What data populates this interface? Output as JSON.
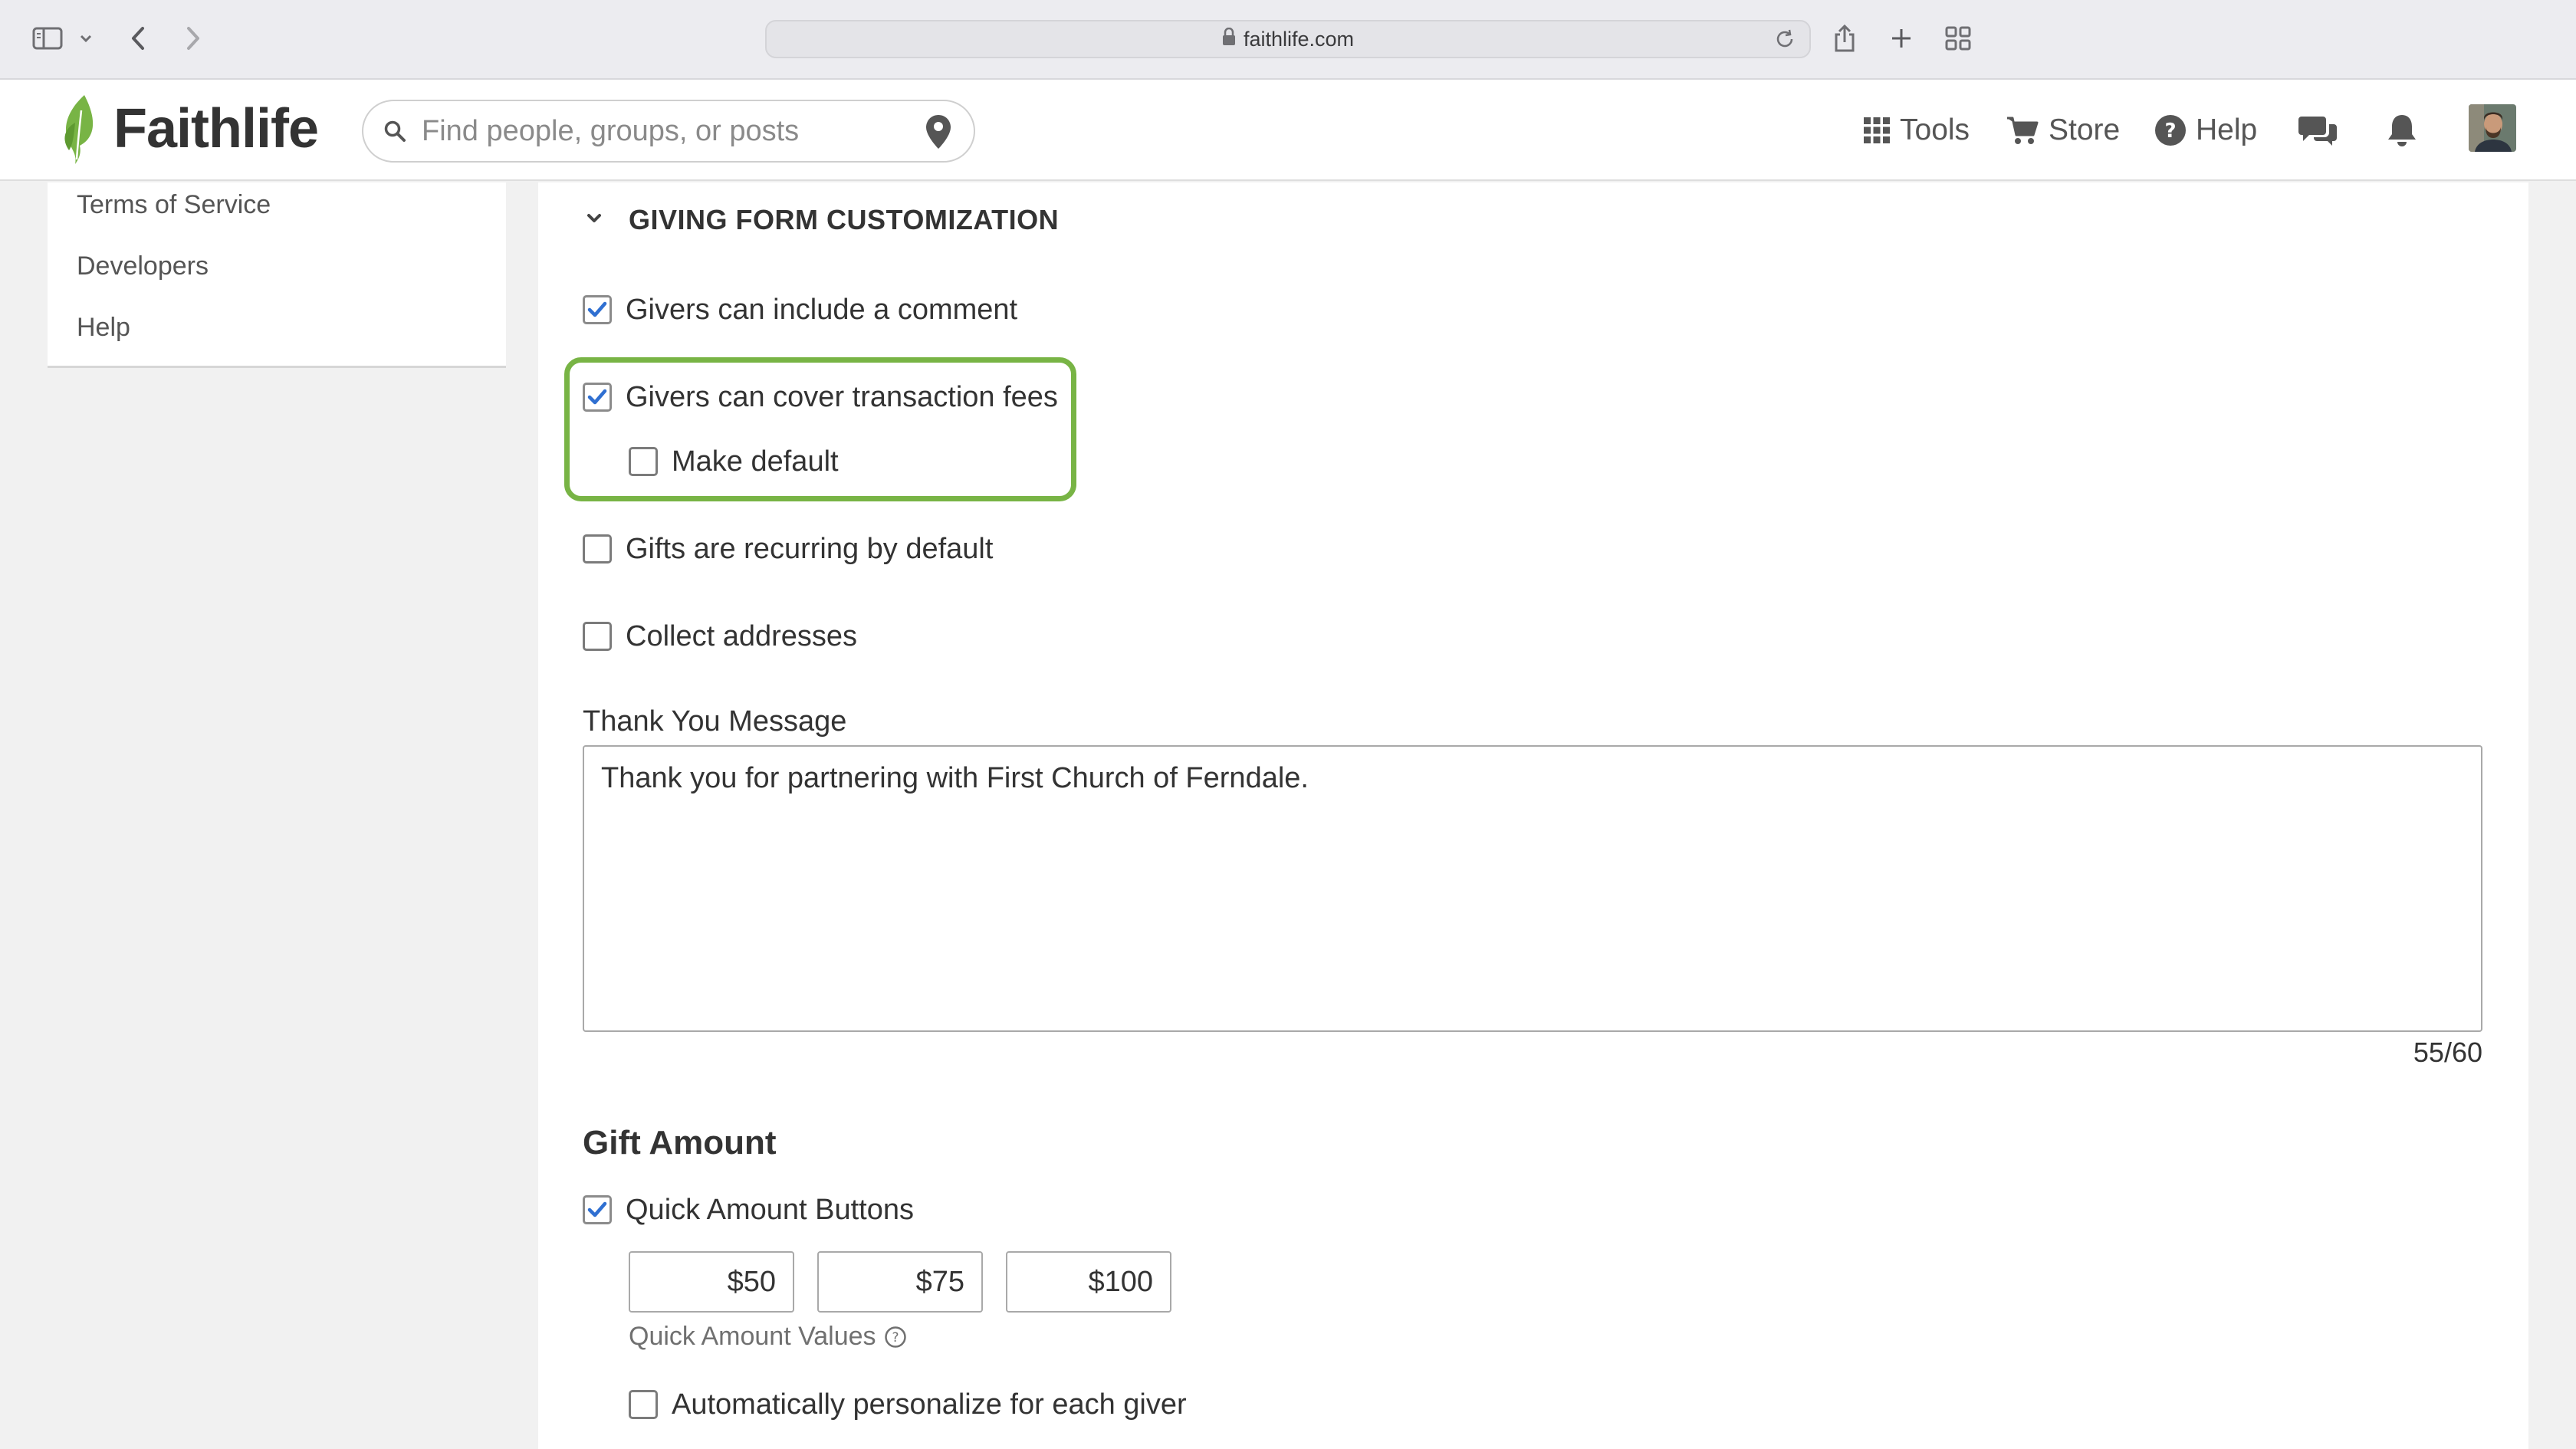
{
  "browser": {
    "url": "faithlife.com"
  },
  "header": {
    "logo_text": "Faithlife",
    "search_placeholder": "Find people, groups, or posts",
    "nav": {
      "tools": "Tools",
      "store": "Store",
      "help": "Help"
    }
  },
  "sidebar": {
    "links": [
      "Terms of Service",
      "Developers",
      "Help"
    ]
  },
  "main": {
    "section_title": "GIVING FORM CUSTOMIZATION",
    "options": {
      "include_comment": {
        "label": "Givers can include a comment",
        "checked": true
      },
      "cover_fees": {
        "label": "Givers can cover transaction fees",
        "checked": true
      },
      "make_default": {
        "label": "Make default",
        "checked": false
      },
      "recurring_default": {
        "label": "Gifts are recurring by default",
        "checked": false
      },
      "collect_addresses": {
        "label": "Collect addresses",
        "checked": false
      }
    },
    "thank_you": {
      "label": "Thank You Message",
      "value": "Thank you for partnering with First Church of Ferndale.",
      "char_count": "55/60"
    },
    "gift_amount": {
      "heading": "Gift Amount",
      "quick_buttons": {
        "label": "Quick Amount Buttons",
        "checked": true
      },
      "values": [
        "$50",
        "$75",
        "$100"
      ],
      "values_caption": "Quick Amount Values",
      "personalize": {
        "label": "Automatically personalize for each giver",
        "checked": false
      }
    }
  },
  "colors": {
    "brand_green": "#78b445",
    "checkbox_blue": "#2f6fd1"
  }
}
